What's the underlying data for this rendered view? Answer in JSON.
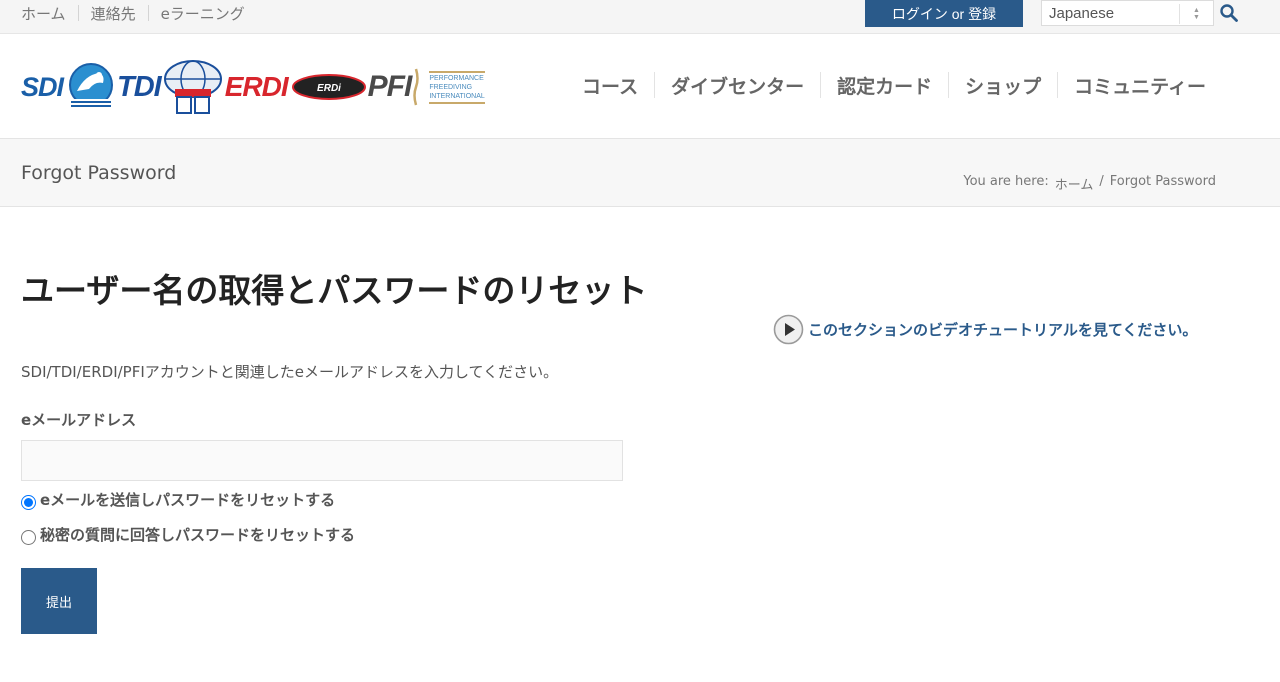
{
  "topbar": {
    "links": [
      "ホーム",
      "連絡先",
      "eラーニング"
    ],
    "login_label": "ログイン or 登録",
    "language_selected": "Japanese"
  },
  "logos": {
    "sdi": "SDI",
    "tdi": "TDI",
    "erdi": "ERDI",
    "pfi": "PFI",
    "pfi_sub": [
      "PERFORMANCE",
      "FREEDIVING",
      "INTERNATIONAL"
    ]
  },
  "nav": {
    "items": [
      "コース",
      "ダイブセンター",
      "認定カード",
      "ショップ",
      "コミュニティー"
    ]
  },
  "titlebar": {
    "title": "Forgot Password",
    "breadcrumb_prefix": "You are here:",
    "breadcrumb_home": "ホーム",
    "breadcrumb_sep": "/",
    "breadcrumb_current": "Forgot Password"
  },
  "content": {
    "heading": "ユーザー名の取得とパスワードのリセット",
    "video_link": "このセクションのビデオチュートリアルを見てください。",
    "intro": "SDI/TDI/ERDI/PFIアカウントと関連したeメールアドレスを入力してください。",
    "email_label": "eメールアドレス",
    "email_value": "",
    "option_email": "eメールを送信しパスワードをリセットする",
    "option_question": "秘密の質問に回答しパスワードをリセットする",
    "selected_option": "email",
    "submit_label": "提出"
  },
  "colors": {
    "primary": "#2a5a8a",
    "sdi_blue": "#1a5fa8",
    "erdi_red": "#d8262d"
  },
  "icons": {
    "search": "search-icon",
    "play": "play-icon",
    "select_arrows": "updown-arrows-icon"
  }
}
